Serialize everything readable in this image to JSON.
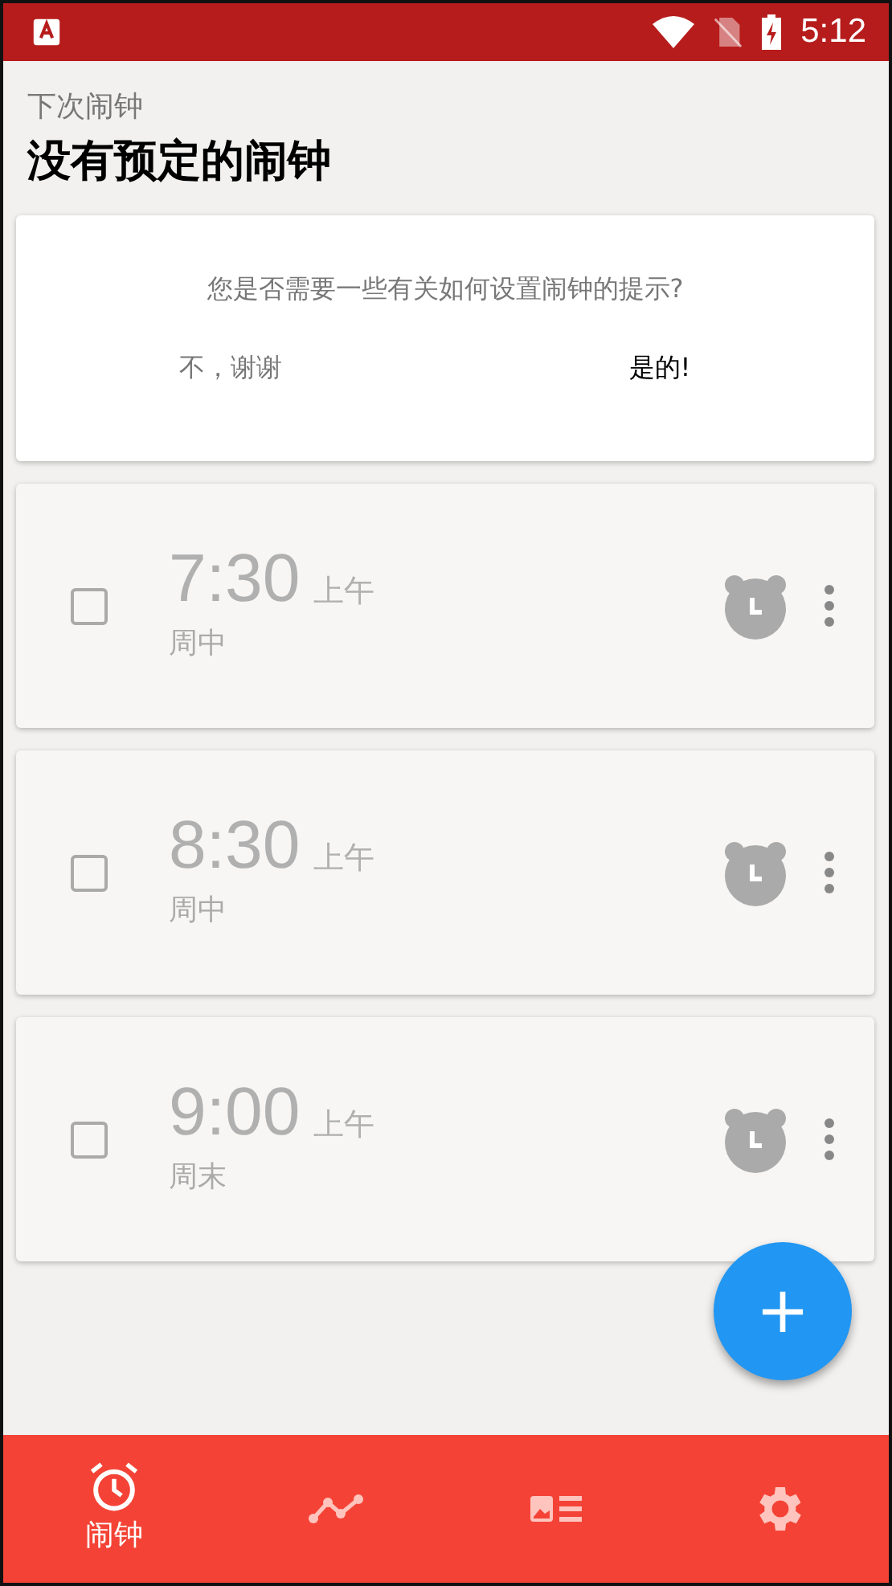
{
  "status_bar": {
    "time": "5:12"
  },
  "header": {
    "caption": "下次闹钟",
    "title": "没有预定的闹钟"
  },
  "hint_card": {
    "question": "您是否需要一些有关如何设置闹钟的提示?",
    "buttons": [
      "不，谢谢",
      "是的!"
    ]
  },
  "alarms": [
    {
      "time": "7:30",
      "period": "上午",
      "days": "周中",
      "checked": false
    },
    {
      "time": "8:30",
      "period": "上午",
      "days": "周中",
      "checked": false
    },
    {
      "time": "9:00",
      "period": "上午",
      "days": "周末",
      "checked": false
    }
  ],
  "fab": {
    "label": "+"
  },
  "bottom_nav": [
    {
      "kind": "alarm",
      "label": "闹钟",
      "selected": true
    },
    {
      "kind": "chart",
      "selected": false
    },
    {
      "kind": "card",
      "selected": false
    },
    {
      "kind": "settings",
      "selected": false
    }
  ]
}
